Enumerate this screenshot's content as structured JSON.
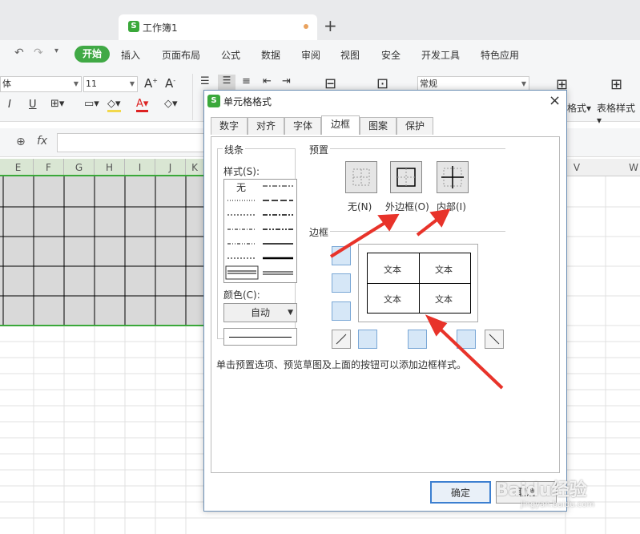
{
  "window": {
    "tab_title": "工作簿1",
    "tab_logo": "S",
    "new_tab": "+"
  },
  "menu": {
    "start": "开始",
    "items": [
      "插入",
      "页面布局",
      "公式",
      "数据",
      "审阅",
      "视图",
      "安全",
      "开发工具",
      "特色应用"
    ]
  },
  "ribbon": {
    "font_name": "体",
    "font_size": "11",
    "number_format": "常规",
    "format_label": "格式",
    "table_style_label": "表格样式"
  },
  "formula": {
    "fx": "fx"
  },
  "columns": [
    "E",
    "F",
    "G",
    "H",
    "I",
    "J",
    "K",
    "V",
    "W"
  ],
  "dialog": {
    "title": "单元格格式",
    "logo": "S",
    "close": "×",
    "tabs": [
      "数字",
      "对齐",
      "字体",
      "边框",
      "图案",
      "保护"
    ],
    "active_tab": "边框",
    "line_group": "线条",
    "style_label": "样式(S):",
    "style_none": "无",
    "color_label": "颜色(C):",
    "color_value": "自动",
    "preset_group": "预置",
    "preset_none": "无(N)",
    "preset_outline": "外边框(O)",
    "preset_inside": "内部(I)",
    "border_group": "边框",
    "preview_cells": [
      "文本",
      "文本",
      "文本",
      "文本"
    ],
    "hint": "单击预置选项、预览草图及上面的按钮可以添加边框样式。",
    "ok": "确定",
    "cancel": "取消"
  },
  "watermark": {
    "text": "Baidu经验",
    "sub": "jingyan.baidu.com"
  },
  "colors": {
    "accent_green": "#40a945",
    "annotation_red": "#e8332a",
    "selection_border": "#3aa83a",
    "cell_fill": "#d9d9d9"
  }
}
